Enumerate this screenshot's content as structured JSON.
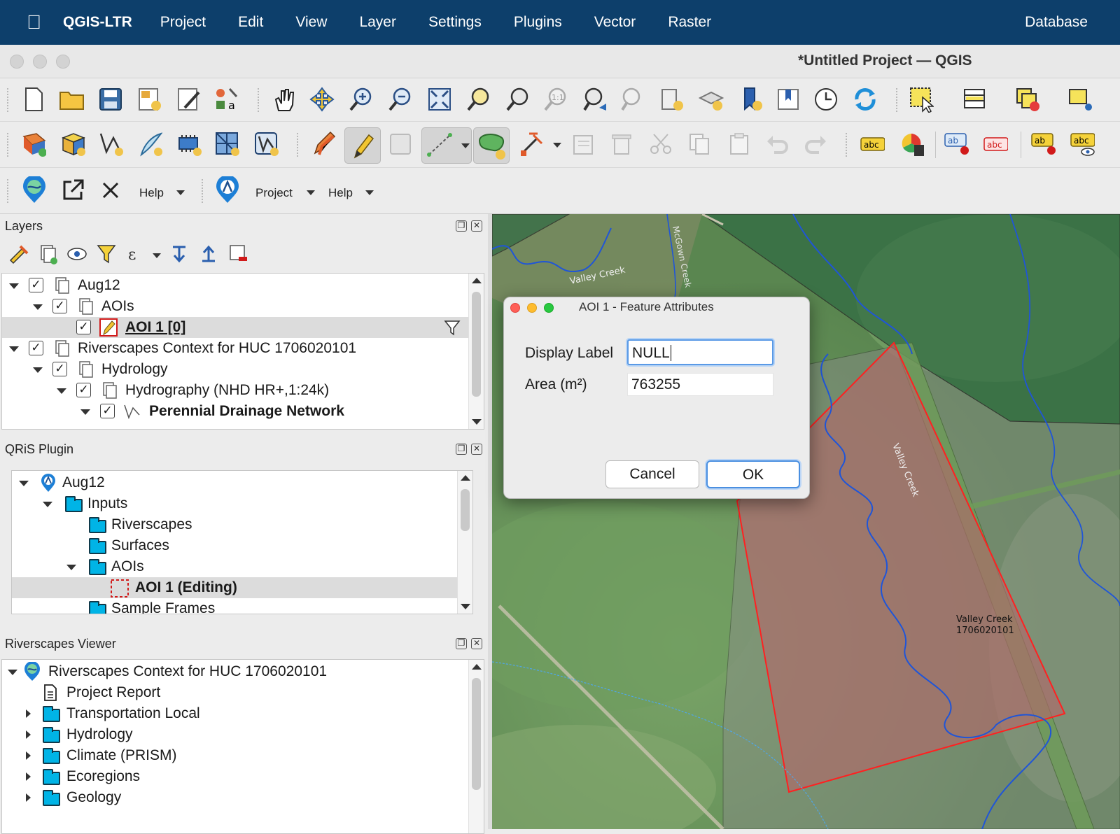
{
  "menubar": {
    "app_name": "QGIS-LTR",
    "items": [
      "Project",
      "Edit",
      "View",
      "Layer",
      "Settings",
      "Plugins",
      "Vector",
      "Raster"
    ],
    "last_item": "Database"
  },
  "window": {
    "title": "*Untitled Project — QGIS"
  },
  "plugin_toolbar": {
    "help1_label": "Help",
    "project_label": "Project",
    "help2_label": "Help"
  },
  "layers_panel": {
    "title": "Layers",
    "rows": [
      {
        "label": "Aug12",
        "checked": true,
        "expanded": true
      },
      {
        "label": "AOIs",
        "checked": true,
        "expanded": true
      },
      {
        "label": "AOI 1 [0]",
        "checked": true,
        "selected": true
      },
      {
        "label": "Riverscapes Context for HUC 1706020101",
        "checked": true,
        "expanded": true
      },
      {
        "label": "Hydrology",
        "checked": true,
        "expanded": true
      },
      {
        "label": "Hydrography (NHD HR+,1:24k)",
        "checked": true,
        "expanded": true
      },
      {
        "label": "Perennial Drainage Network",
        "checked": true,
        "expanded": true
      }
    ]
  },
  "qris_panel": {
    "title": "QRiS Plugin",
    "rows": [
      {
        "label": "Aug12"
      },
      {
        "label": "Inputs"
      },
      {
        "label": "Riverscapes"
      },
      {
        "label": "Surfaces"
      },
      {
        "label": "AOIs"
      },
      {
        "label": "AOI 1 (Editing)",
        "selected": true
      },
      {
        "label": "Sample Frames"
      }
    ]
  },
  "riverscapes_panel": {
    "title": "Riverscapes Viewer",
    "rows": [
      {
        "label": "Riverscapes Context for HUC 1706020101"
      },
      {
        "label": "Project Report"
      },
      {
        "label": "Transportation Local"
      },
      {
        "label": "Hydrology"
      },
      {
        "label": "Climate (PRISM)"
      },
      {
        "label": "Ecoregions"
      },
      {
        "label": "Geology"
      }
    ]
  },
  "map": {
    "labels": {
      "mcgown": "McGown Creek",
      "valley_creek_top": "Valley Creek",
      "valley_creek_mid": "Valley Creek",
      "huc_line1": "Valley Creek",
      "huc_line2": "1706020101"
    },
    "colors": {
      "aoi_fill": "#b06a6a",
      "aoi_stroke": "#ff2020",
      "stream": "#1f55d8"
    }
  },
  "dialog": {
    "title": "AOI 1 - Feature Attributes",
    "display_label_label": "Display Label",
    "display_label_value": "NULL",
    "area_label": "Area (m²)",
    "area_value": "763255",
    "cancel_label": "Cancel",
    "ok_label": "OK"
  }
}
